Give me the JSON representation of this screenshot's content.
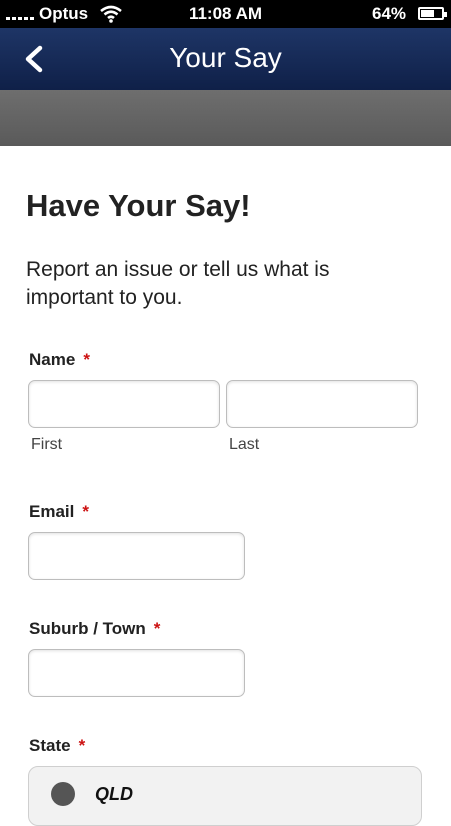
{
  "status_bar": {
    "carrier": "Optus",
    "time": "11:08 AM",
    "battery": "64%",
    "battery_level": 0.64,
    "icons": [
      "signal-icon",
      "wifi-icon",
      "battery-icon"
    ]
  },
  "nav": {
    "title": "Your Say",
    "back_icon": "chevron-left-icon"
  },
  "form": {
    "heading": "Have Your Say!",
    "intro": "Report an issue or tell us what is important to you.",
    "required_mark": "*",
    "name": {
      "label": "Name",
      "first_value": "",
      "last_value": "",
      "first_sublabel": "First",
      "last_sublabel": "Last"
    },
    "email": {
      "label": "Email",
      "value": ""
    },
    "suburb": {
      "label": "Suburb / Town",
      "value": ""
    },
    "state": {
      "label": "State",
      "options": [
        "QLD"
      ]
    }
  },
  "colors": {
    "nav_background": "#142a5a",
    "required": "#cc1111",
    "gray_band": "#5f5f5f"
  }
}
